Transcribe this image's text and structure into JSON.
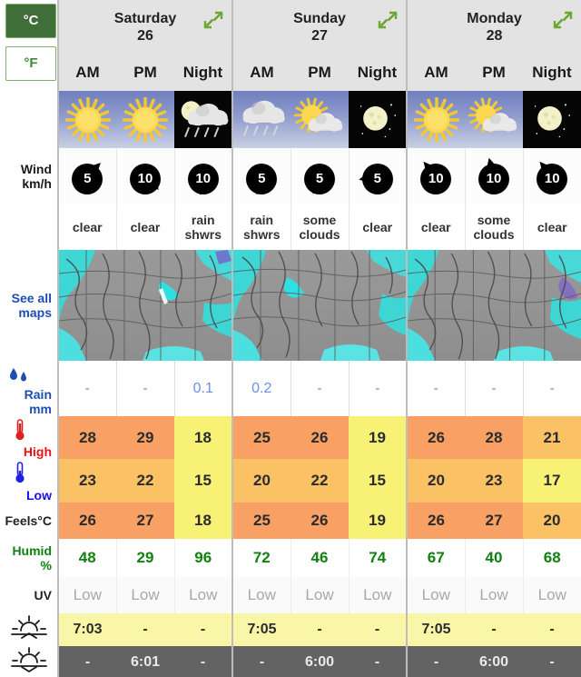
{
  "units": {
    "celsius": "°C",
    "fahrenheit": "°F",
    "active": "celsius"
  },
  "labels": {
    "wind": "Wind",
    "wind_unit": "km/h",
    "see_all_maps_1": "See all",
    "see_all_maps_2": "maps",
    "rain": "Rain",
    "rain_unit": "mm",
    "high": "High",
    "low": "Low",
    "feels": "Feels°C",
    "humid": "Humid",
    "humid_unit": "%",
    "uv": "UV"
  },
  "days": [
    {
      "name": "Saturday",
      "date": "26",
      "slots": [
        "AM",
        "PM",
        "Night"
      ]
    },
    {
      "name": "Sunday",
      "date": "27",
      "slots": [
        "AM",
        "PM",
        "Night"
      ]
    },
    {
      "name": "Monday",
      "date": "28",
      "slots": [
        "AM",
        "PM",
        "Night"
      ]
    }
  ],
  "columns": [
    {
      "day": "Saturday",
      "slot": "AM",
      "icon": "sun",
      "night": false,
      "wind_speed": "5",
      "wind_dir": 45,
      "desc": "clear",
      "rain": "-",
      "high": "28",
      "low": "23",
      "feels": "26",
      "humid": "48",
      "uv": "Low",
      "sunrise": "7:03",
      "sunset": "-",
      "high_color": "#f9a165",
      "low_color": "#fbc265",
      "feels_color": "#f9a165"
    },
    {
      "day": "Saturday",
      "slot": "PM",
      "icon": "sun",
      "night": false,
      "wind_speed": "10",
      "wind_dir": 135,
      "desc": "clear",
      "rain": "-",
      "high": "29",
      "low": "22",
      "feels": "27",
      "humid": "29",
      "uv": "Low",
      "sunrise": "-",
      "sunset": "6:01",
      "high_color": "#f9a165",
      "low_color": "#fbc265",
      "feels_color": "#f9a165"
    },
    {
      "day": "Saturday",
      "slot": "Night",
      "icon": "moon-rain",
      "night": true,
      "wind_speed": "10",
      "wind_dir": 190,
      "desc": "rain shwrs",
      "rain": "0.1",
      "high": "18",
      "low": "15",
      "feels": "18",
      "humid": "96",
      "uv": "Low",
      "sunrise": "-",
      "sunset": "-",
      "high_color": "#f7f176",
      "low_color": "#f7f176",
      "feels_color": "#f7f176"
    },
    {
      "day": "Sunday",
      "slot": "AM",
      "icon": "cloud-rain",
      "night": false,
      "wind_speed": "5",
      "wind_dir": 195,
      "desc": "rain shwrs",
      "rain": "0.2",
      "high": "25",
      "low": "20",
      "feels": "25",
      "humid": "72",
      "uv": "Low",
      "sunrise": "7:05",
      "sunset": "-",
      "high_color": "#f9a165",
      "low_color": "#fbc265",
      "feels_color": "#f9a165"
    },
    {
      "day": "Sunday",
      "slot": "PM",
      "icon": "sun-cloud",
      "night": false,
      "wind_speed": "5",
      "wind_dir": 200,
      "desc": "some clouds",
      "rain": "-",
      "high": "26",
      "low": "22",
      "feels": "26",
      "humid": "46",
      "uv": "Low",
      "sunrise": "-",
      "sunset": "6:00",
      "high_color": "#f9a165",
      "low_color": "#fbc265",
      "feels_color": "#f9a165"
    },
    {
      "day": "Sunday",
      "slot": "Night",
      "icon": "moon",
      "night": true,
      "wind_speed": "5",
      "wind_dir": 260,
      "desc": "clear",
      "rain": "-",
      "high": "19",
      "low": "15",
      "feels": "19",
      "humid": "74",
      "uv": "Low",
      "sunrise": "-",
      "sunset": "-",
      "high_color": "#f7f176",
      "low_color": "#f7f176",
      "feels_color": "#f7f176"
    },
    {
      "day": "Monday",
      "slot": "AM",
      "icon": "sun",
      "night": false,
      "wind_speed": "10",
      "wind_dir": 320,
      "desc": "clear",
      "rain": "-",
      "high": "26",
      "low": "20",
      "feels": "26",
      "humid": "67",
      "uv": "Low",
      "sunrise": "7:05",
      "sunset": "-",
      "high_color": "#f9a165",
      "low_color": "#fbc265",
      "feels_color": "#f9a165"
    },
    {
      "day": "Monday",
      "slot": "PM",
      "icon": "sun-cloud",
      "night": false,
      "wind_speed": "10",
      "wind_dir": 345,
      "desc": "some clouds",
      "rain": "-",
      "high": "28",
      "low": "23",
      "feels": "27",
      "humid": "40",
      "uv": "Low",
      "sunrise": "-",
      "sunset": "6:00",
      "high_color": "#f9a165",
      "low_color": "#fbc265",
      "feels_color": "#f9a165"
    },
    {
      "day": "Monday",
      "slot": "Night",
      "icon": "moon",
      "night": true,
      "wind_speed": "10",
      "wind_dir": 320,
      "desc": "clear",
      "rain": "-",
      "high": "21",
      "low": "17",
      "feels": "20",
      "humid": "68",
      "uv": "Low",
      "sunrise": "-",
      "sunset": "-",
      "high_color": "#fbc265",
      "low_color": "#f7f176",
      "feels_color": "#fbc265"
    }
  ],
  "colors": {
    "accent_green": "#3f6e39",
    "link_blue": "#1d4fb0",
    "high_red": "#ee1111",
    "low_blue": "#1111ee",
    "humid_green": "#108010",
    "uv_gray": "#a8a8a8",
    "warm": "#f9a165",
    "mild": "#fbc265",
    "cool": "#f7f176",
    "sunrise_bg": "#f9f6a8",
    "sunset_bg": "#636363"
  }
}
